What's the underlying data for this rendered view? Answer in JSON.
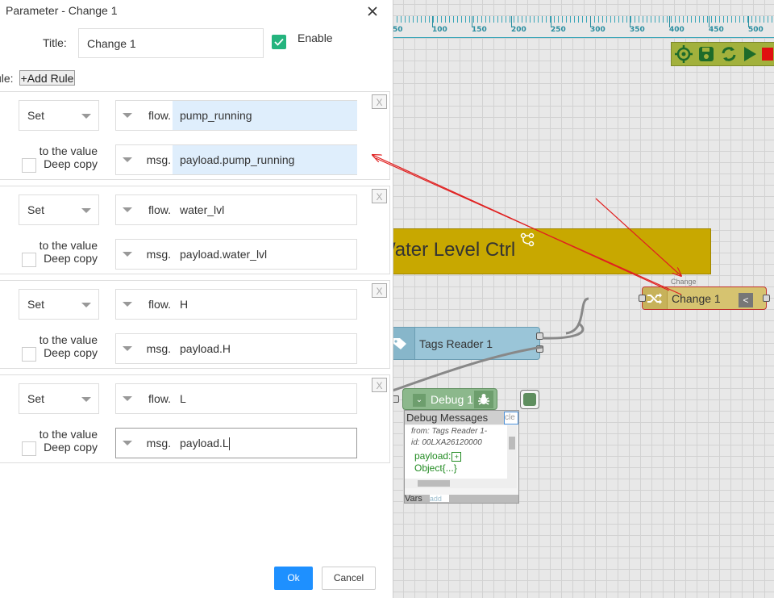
{
  "dialog": {
    "title": "Parameter - Change 1",
    "title_label": "Title:",
    "title_value": "Change 1",
    "enable_label": "Enable",
    "enable_checked": true,
    "rule_label": "ule:",
    "add_rule_label": "+Add Rule",
    "to_the_value_label": "to the value",
    "deep_copy_label": "Deep copy",
    "delete_label": "X",
    "ok_label": "Ok",
    "cancel_label": "Cancel"
  },
  "rules": [
    {
      "action": "Set",
      "target_type": "flow.",
      "target": "pump_running",
      "source_type": "msg.",
      "source": "payload.pump_running",
      "highlight": true
    },
    {
      "action": "Set",
      "target_type": "flow.",
      "target": "water_lvl",
      "source_type": "msg.",
      "source": "payload.water_lvl",
      "highlight": false
    },
    {
      "action": "Set",
      "target_type": "flow.",
      "target": "H",
      "source_type": "msg.",
      "source": "payload.H",
      "highlight": false
    },
    {
      "action": "Set",
      "target_type": "flow.",
      "target": "L",
      "source_type": "msg.",
      "source": "payload.L",
      "highlight": false
    }
  ],
  "canvas": {
    "ruler_labels": [
      "50",
      "100",
      "150",
      "200",
      "250",
      "300",
      "350",
      "400",
      "450",
      "500"
    ],
    "toolbar_icons": [
      "locate-icon",
      "save-icon",
      "refresh-icon",
      "play-icon",
      "stop-icon"
    ],
    "nodes": {
      "water": "Water Level Ctrl",
      "change_type": "Change",
      "change": "Change 1",
      "tags": "Tags Reader 1",
      "debug": "Debug 1"
    },
    "debug_panel": {
      "header": "Debug Messages",
      "clear": "cle",
      "from": "from: Tags Reader 1-",
      "id": "id: 00LXA26120000",
      "payload": "payload:",
      "object": "Object{...}",
      "footer": "Vars",
      "footer_input": "add"
    }
  },
  "colors": {
    "accent": "#1e90ff",
    "enable_green": "#24b47e",
    "water_node": "#c8a800",
    "change_node": "#d6c370",
    "tags_node": "#9ac5d8",
    "debug_node": "#8cb88c",
    "annotation_red": "#e02020"
  }
}
